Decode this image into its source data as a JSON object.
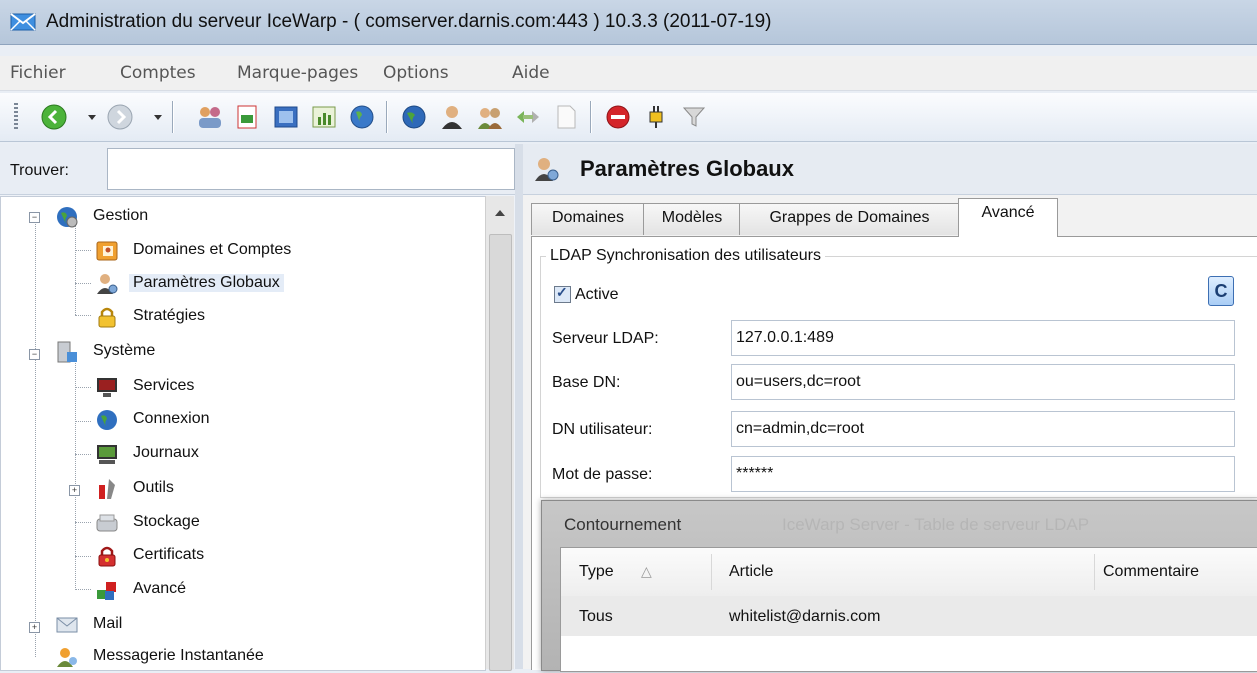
{
  "window": {
    "title": "Administration du serveur IceWarp - ( comserver.darnis.com:443 ) 10.3.3 (2011-07-19)"
  },
  "menu": [
    "Fichier",
    "Comptes",
    "Marque-pages",
    "Options",
    "Aide"
  ],
  "toolbar": {
    "icons": [
      "back-arrow-icon",
      "forward-arrow-icon",
      "users-icon",
      "report-icon",
      "book-icon",
      "chart-icon",
      "globe-icon",
      "globe-icon",
      "user-icon",
      "group-icon",
      "arrows-icon",
      "document-icon",
      "stop-icon",
      "plugin-icon",
      "filter-icon"
    ]
  },
  "finder": {
    "label": "Trouver:",
    "value": ""
  },
  "tree": {
    "items": [
      {
        "label": "Gestion",
        "icon": "globe-gear-icon"
      },
      {
        "label": "Domaines et Comptes",
        "icon": "contacts-icon"
      },
      {
        "label": "Paramètres Globaux",
        "icon": "user-settings-icon"
      },
      {
        "label": "Stratégies",
        "icon": "lock-icon"
      },
      {
        "label": "Système",
        "icon": "server-icon"
      },
      {
        "label": "Services",
        "icon": "monitor-icon"
      },
      {
        "label": "Connexion",
        "icon": "globe-icon"
      },
      {
        "label": "Journaux",
        "icon": "log-monitor-icon"
      },
      {
        "label": "Outils",
        "icon": "tools-icon"
      },
      {
        "label": "Stockage",
        "icon": "disk-icon"
      },
      {
        "label": "Certificats",
        "icon": "certificate-lock-icon"
      },
      {
        "label": "Avancé",
        "icon": "cubes-icon"
      },
      {
        "label": "Mail",
        "icon": "mail-icon"
      },
      {
        "label": "Messagerie Instantanée",
        "icon": "messenger-icon"
      }
    ]
  },
  "panel": {
    "title": "Paramètres Globaux",
    "tabs": [
      "Domaines",
      "Modèles",
      "Grappes de Domaines",
      "Avancé"
    ],
    "active_tab": "Avancé",
    "group_title": "LDAP Synchronisation des utilisateurs",
    "active": {
      "label": "Active",
      "checked": true
    },
    "c_button": "C",
    "fields": [
      {
        "label": "Serveur LDAP:",
        "value": "127.0.0.1:489"
      },
      {
        "label": "Base DN:",
        "value": "ou=users,dc=root"
      },
      {
        "label": "DN utilisateur:",
        "value": "cn=admin,dc=root"
      },
      {
        "label": "Mot de passe:",
        "value": "******"
      }
    ]
  },
  "dialog": {
    "title": "Contournement",
    "background_title": "IceWarp Server - Table de serveur LDAP",
    "columns": [
      "Type",
      "Article",
      "Commentaire"
    ],
    "sort_indicator": "△",
    "rows": [
      {
        "type": "Tous",
        "article": "whitelist@darnis.com",
        "comment": ""
      }
    ]
  },
  "colors": {
    "titlebar": "#b5c6da",
    "selection": "#e4ecf7",
    "accent": "#3d6fb3"
  }
}
